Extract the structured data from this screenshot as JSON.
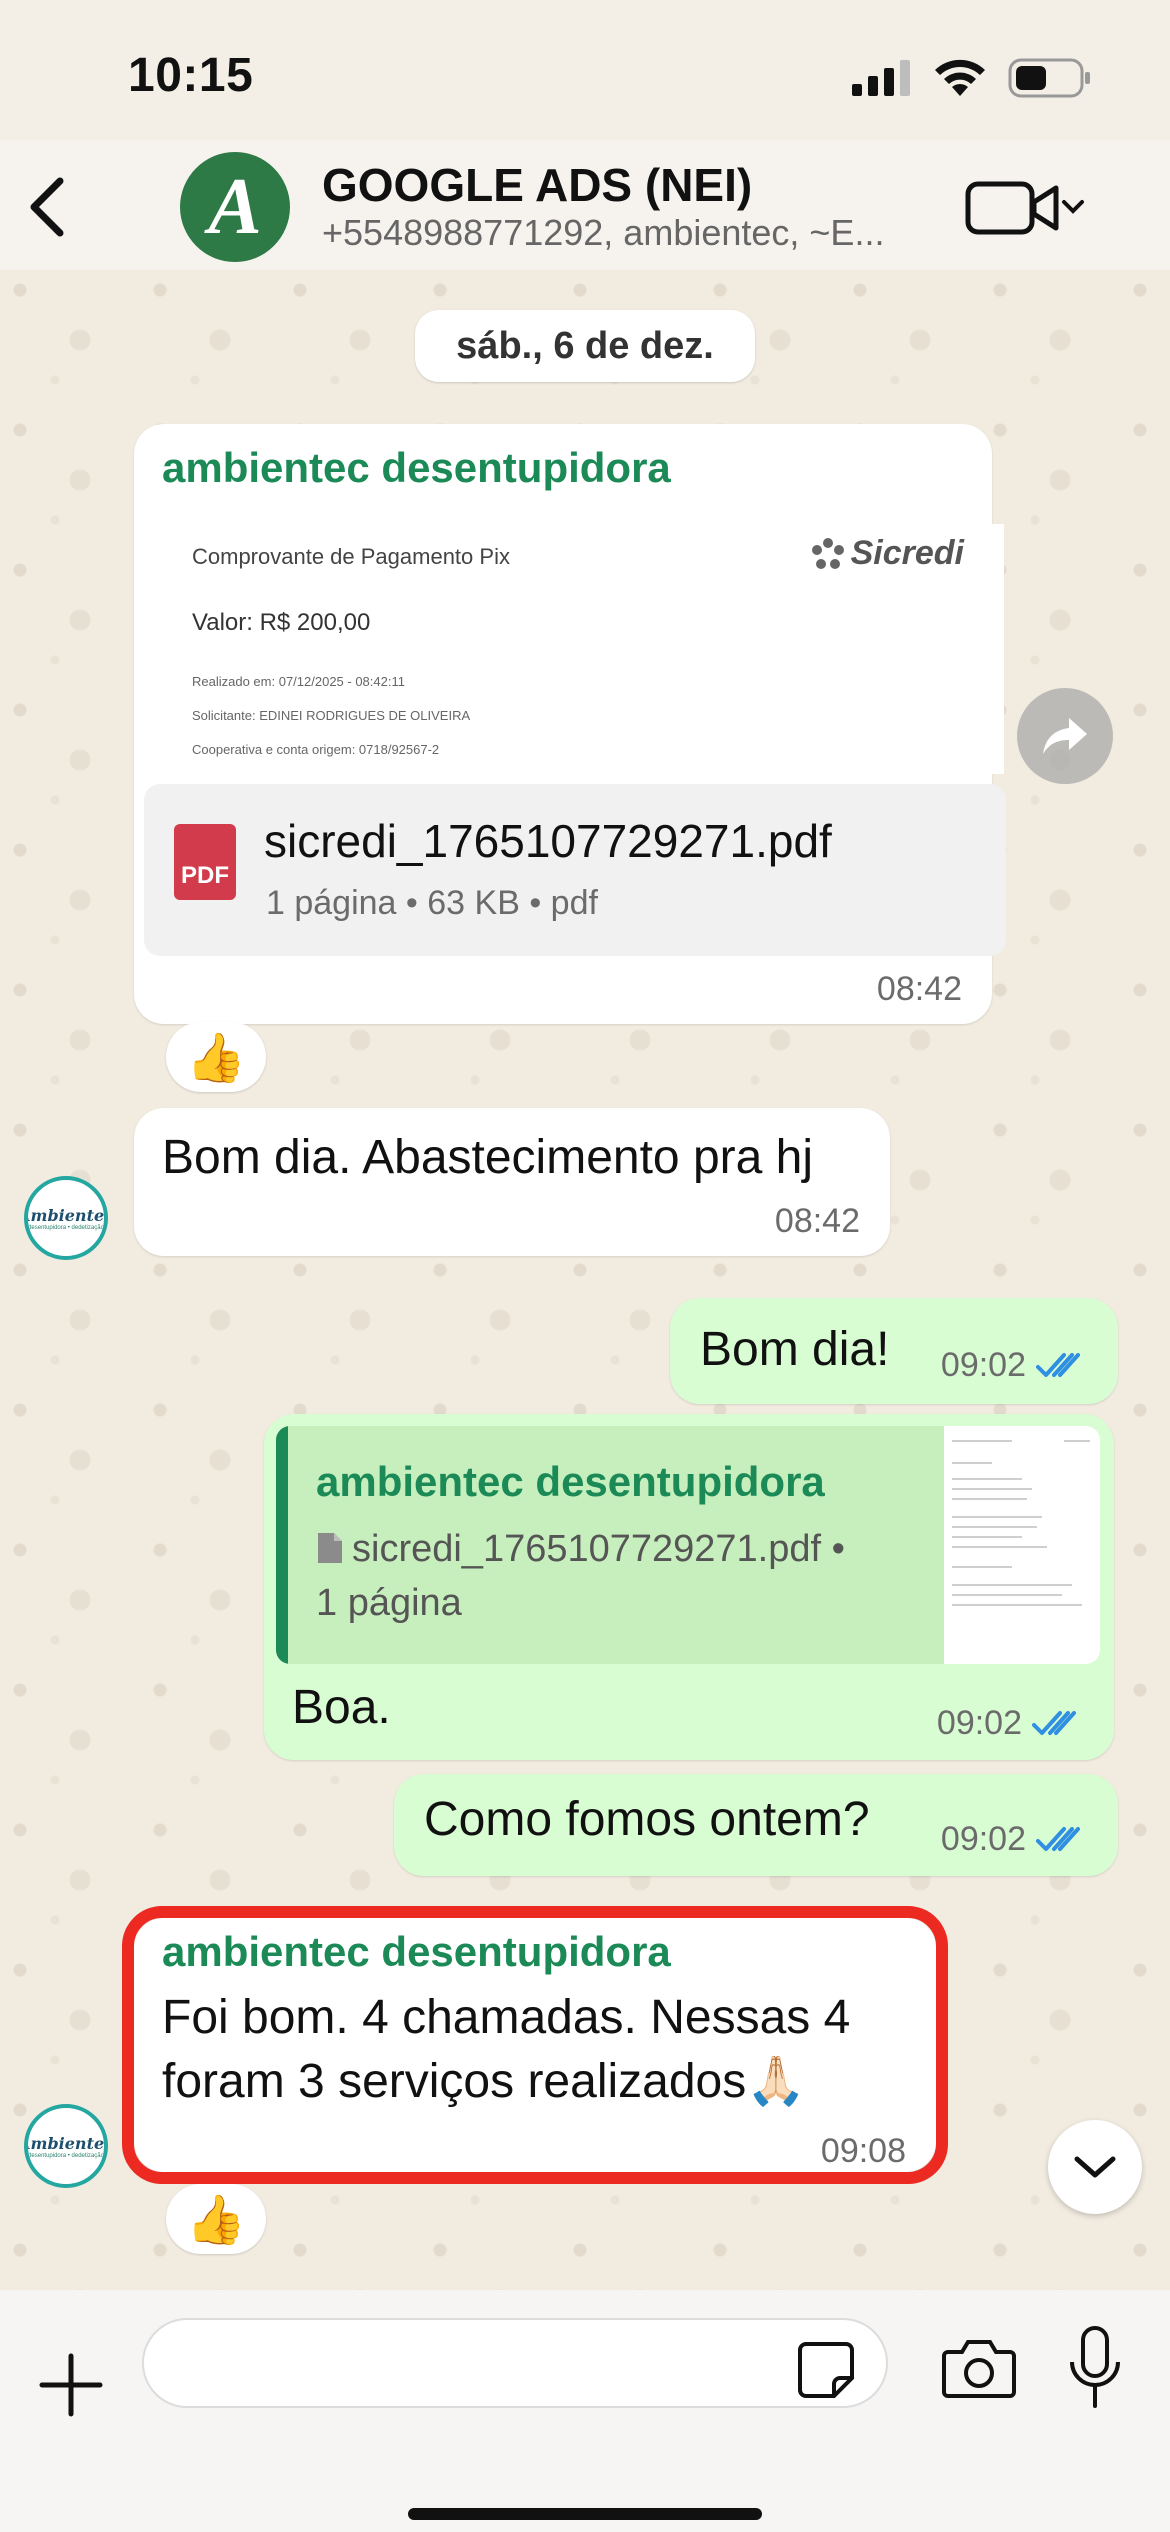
{
  "status_bar": {
    "time": "10:15"
  },
  "header": {
    "back_label": "<",
    "avatar_letter": "A",
    "title": "GOOGLE ADS (NEI)",
    "subtitle": "+5548988771292, ambientec, ~E..."
  },
  "chat": {
    "date_separator": "sáb., 6 de dez.",
    "messages": [
      {
        "sender": "ambientec desentupidora",
        "document": {
          "preview_title": "Comprovante de Pagamento Pix",
          "preview_brand": "Sicredi",
          "preview_value": "Valor: R$ 200,00",
          "preview_lines": [
            "Realizado em: 07/12/2025 - 08:42:11",
            "Solicitante: EDINEI RODRIGUES DE OLIVEIRA",
            "Cooperativa e conta origem: 0718/92567-2"
          ],
          "file_name": "sicredi_1765107729271.pdf",
          "file_icon_label": "PDF",
          "file_info": "1 página • 63 KB • pdf"
        },
        "time": "08:42",
        "reaction": "👍"
      },
      {
        "text": "Bom dia. Abastecimento pra hj",
        "time": "08:42",
        "avatar_text": "Ambientec",
        "avatar_sub": "desentupidora • dedetização"
      },
      {
        "text": "Bom dia!",
        "time": "09:02"
      },
      {
        "quote": {
          "sender": "ambientec desentupidora",
          "text": "sicredi_1765107729271.pdf • 1 página"
        },
        "text": "Boa.",
        "time": "09:02"
      },
      {
        "text": "Como fomos ontem?",
        "time": "09:02"
      },
      {
        "sender": "ambientec desentupidora",
        "text": "Foi bom. 4 chamadas. Nessas 4 foram 3 serviços realizados🙏🏻",
        "time": "09:08",
        "reaction": "👍",
        "avatar_text": "Ambientec",
        "avatar_sub": "desentupidora • dedetização"
      }
    ]
  },
  "composer": {
    "placeholder": ""
  },
  "colors": {
    "accent_green": "#1b8a57",
    "outgoing_bubble": "#d9fdd3",
    "highlight_red": "#ec2a22",
    "read_ticks": "#2f8fe0"
  }
}
